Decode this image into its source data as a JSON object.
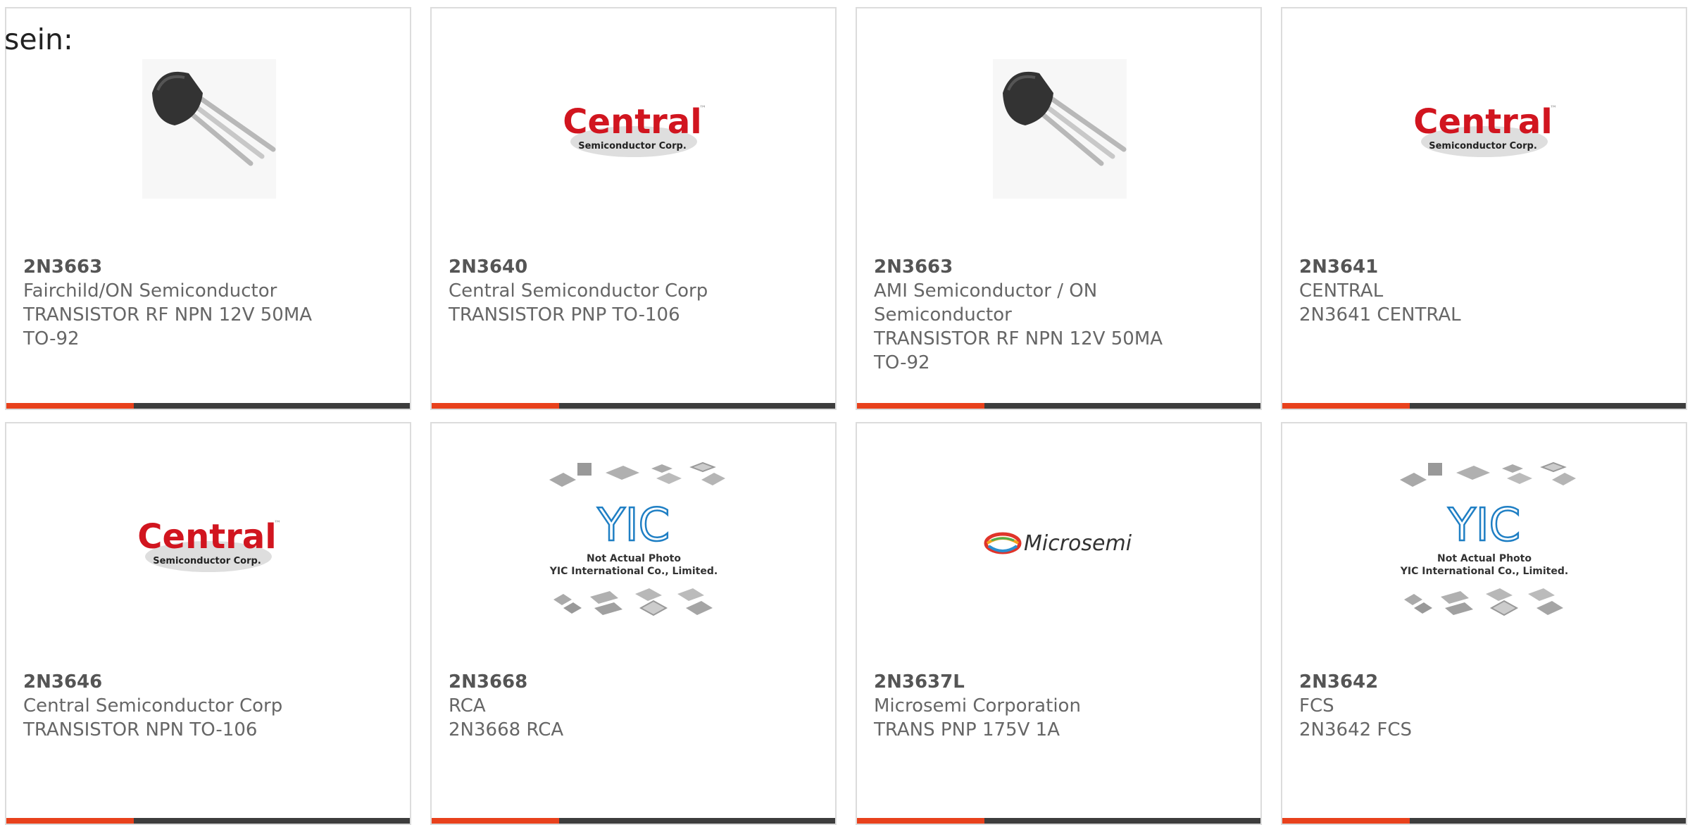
{
  "heading": "sein:",
  "products": [
    {
      "part": "2N3663",
      "manufacturer": "Fairchild/ON Semiconductor",
      "desc1": "TRANSISTOR RF NPN 12V 50MA",
      "desc2": "TO-92",
      "image": "to92-transistor-photo"
    },
    {
      "part": "2N3640",
      "manufacturer": "Central Semiconductor Corp",
      "desc1": "TRANSISTOR PNP TO-106",
      "desc2": "",
      "image": "central-semiconductor-logo"
    },
    {
      "part": "2N3663",
      "manufacturer": "AMI Semiconductor / ON Semiconductor",
      "desc1": "TRANSISTOR RF NPN 12V 50MA",
      "desc2": "TO-92",
      "image": "to92-transistor-photo"
    },
    {
      "part": "2N3641",
      "manufacturer": "CENTRAL",
      "desc1": "2N3641 CENTRAL",
      "desc2": "",
      "image": "central-semiconductor-logo"
    },
    {
      "part": "2N3646",
      "manufacturer": "Central Semiconductor Corp",
      "desc1": "TRANSISTOR NPN TO-106",
      "desc2": "",
      "image": "central-semiconductor-logo"
    },
    {
      "part": "2N3668",
      "manufacturer": "RCA",
      "desc1": "2N3668 RCA",
      "desc2": "",
      "image": "yic-placeholder"
    },
    {
      "part": "2N3637L",
      "manufacturer": "Microsemi Corporation",
      "desc1": "TRANS PNP 175V 1A",
      "desc2": "",
      "image": "microsemi-logo"
    },
    {
      "part": "2N3642",
      "manufacturer": "FCS",
      "desc1": "2N3642 FCS",
      "desc2": "",
      "image": "yic-placeholder"
    }
  ],
  "logos": {
    "central_word": "Central",
    "central_tm": "™",
    "central_sub": "Semiconductor Corp.",
    "microsemi_word": "Microsemi",
    "yic_mark": "YIC",
    "yic_line1": "Not Actual Photo",
    "yic_line2": "YIC International Co., Limited."
  },
  "colors": {
    "accent": "#e8411c",
    "bar": "#3d3d3d",
    "central_red": "#d1151f",
    "yic_blue": "#1f7fc4"
  }
}
